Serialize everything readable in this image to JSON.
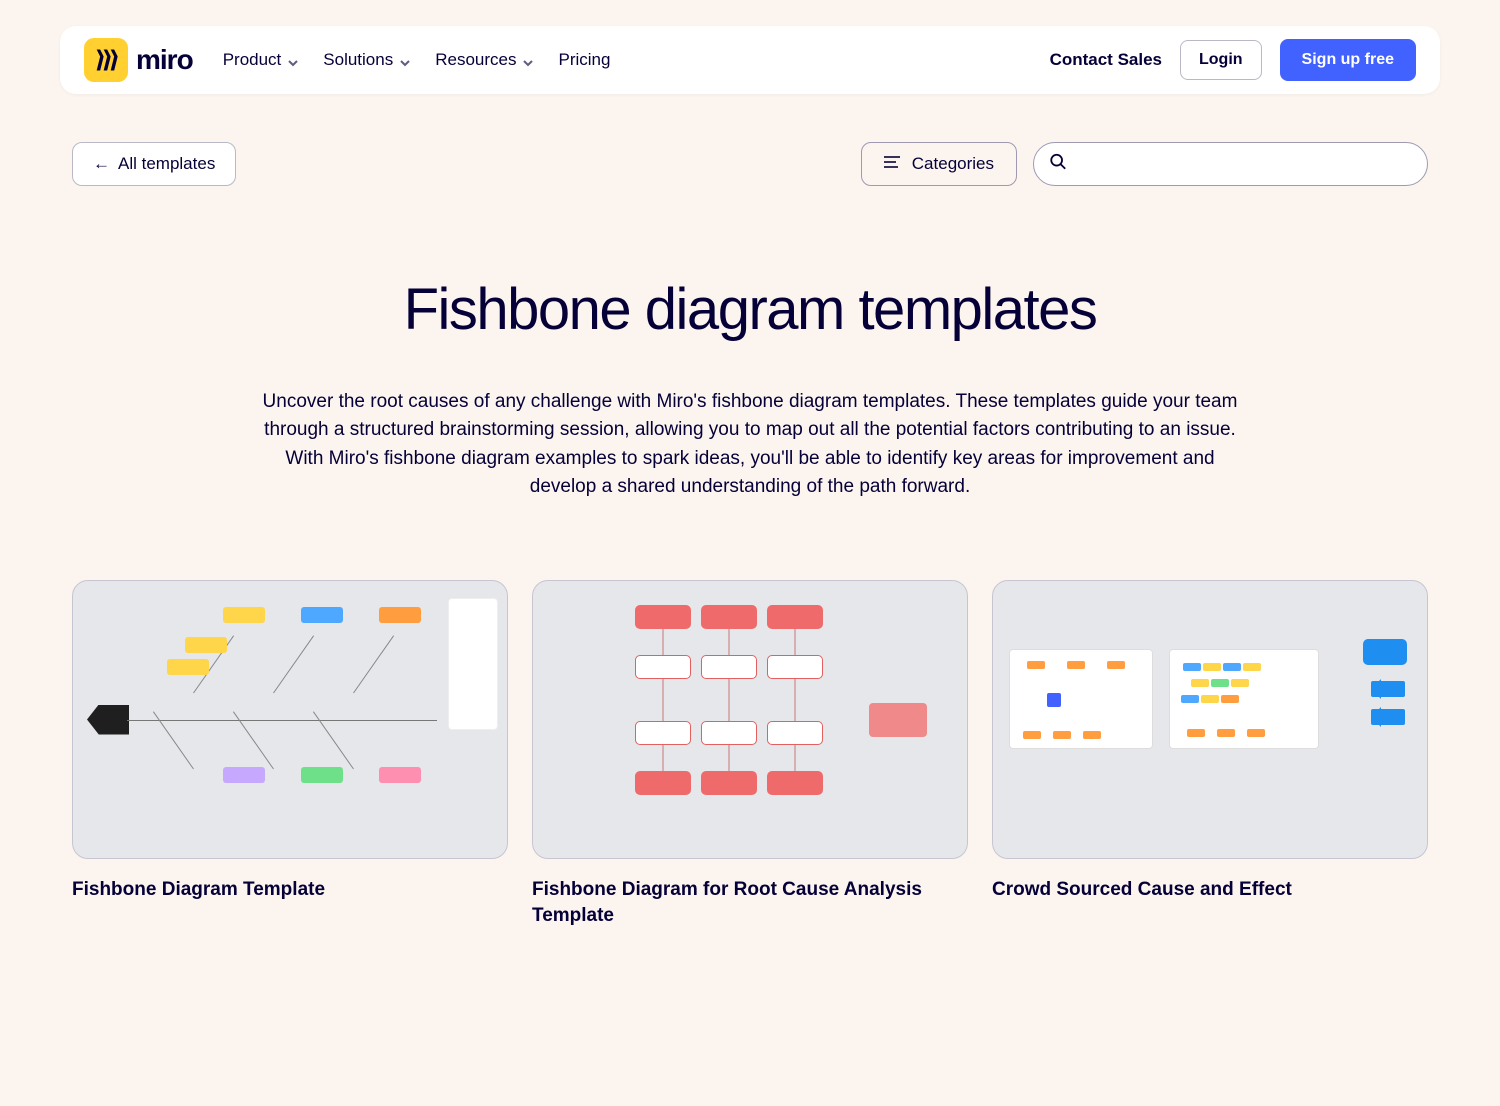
{
  "header": {
    "logo_text": "miro",
    "nav": {
      "product": "Product",
      "solutions": "Solutions",
      "resources": "Resources",
      "pricing": "Pricing"
    },
    "contact_sales": "Contact Sales",
    "login": "Login",
    "signup": "Sign up free"
  },
  "subbar": {
    "back": "All templates",
    "categories": "Categories"
  },
  "hero": {
    "title": "Fishbone diagram templates",
    "description": "Uncover the root causes of any challenge with Miro's fishbone diagram templates. These templates guide your team through a structured brainstorming session, allowing you to map out all the potential factors contributing to an issue. With Miro's fishbone diagram examples to spark ideas, you'll be able to identify key areas for improvement and develop a shared understanding of the path forward."
  },
  "cards": [
    {
      "title": "Fishbone Diagram Template"
    },
    {
      "title": "Fishbone Diagram for Root Cause Analysis Template"
    },
    {
      "title": "Crowd Sourced Cause and Effect"
    }
  ]
}
